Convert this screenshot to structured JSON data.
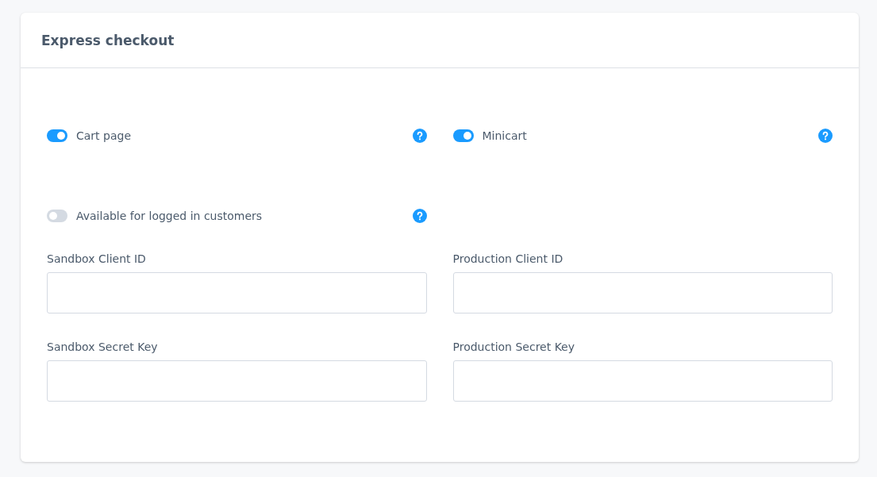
{
  "card": {
    "title": "Express checkout"
  },
  "toggles": [
    {
      "label": "Cart page",
      "on": true
    },
    {
      "label": "Minicart",
      "on": true
    },
    {
      "label": "Available for logged in customers",
      "on": false
    }
  ],
  "fields": [
    {
      "label": "Sandbox Client ID"
    },
    {
      "label": "Production Client ID"
    },
    {
      "label": "Sandbox Secret Key"
    },
    {
      "label": "Production Secret Key"
    }
  ]
}
